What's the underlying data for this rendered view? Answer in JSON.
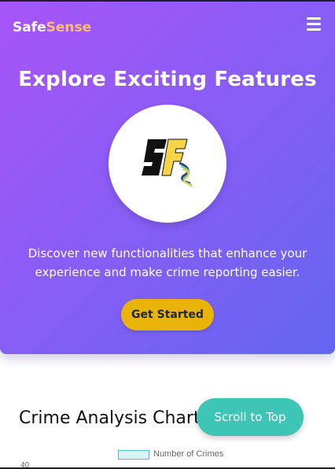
{
  "header": {
    "brand_part1": "Safe",
    "brand_part2": "Sense",
    "menu_icon": "hamburger-menu-icon"
  },
  "hero": {
    "title": "Explore Exciting Features",
    "logo_text": "SF",
    "description": "Discover new functionalities that enhance your experience and make crime reporting easier.",
    "cta_label": "Get Started"
  },
  "chart_section": {
    "title": "Crime Analysis Chart",
    "chart_data": {
      "type": "bar",
      "legend": [
        "Number of Crimes"
      ],
      "series": [
        {
          "name": "Number of Crimes",
          "values": []
        }
      ],
      "y_ticks": [
        "40"
      ],
      "legend_position": "top"
    }
  },
  "scroll_top_label": "Scroll to Top",
  "colors": {
    "hero_gradient_start": "#a855f7",
    "hero_gradient_end": "#6366f1",
    "brand_accent": "#fdba74",
    "cta": "#eab308",
    "scroll_button": "#3fc5b5"
  }
}
